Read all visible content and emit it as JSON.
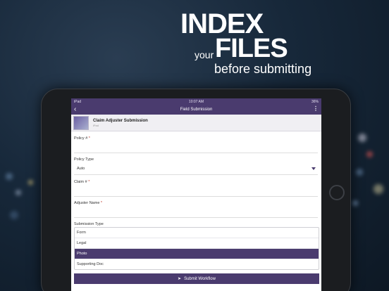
{
  "headline": {
    "line1": "INDEX",
    "your": "your",
    "line2": "FILES",
    "line3": "before submitting"
  },
  "status_bar": {
    "carrier": "iPad",
    "time": "10:07 AM",
    "battery": "36%"
  },
  "nav": {
    "title": "Field Submission"
  },
  "workflow": {
    "title": "Claim Adjuster Submission",
    "subtitle": "iPad"
  },
  "fields": {
    "policy_num_label": "Policy #",
    "policy_type_label": "Policy Type",
    "policy_type_value": "Auto",
    "claim_num_label": "Claim #",
    "adjuster_name_label": "Adjuster Name",
    "submission_type_label": "Submission Type",
    "required_mark": "*"
  },
  "submission_options": [
    "Form",
    "Legal",
    "Photo",
    "Supporting Doc"
  ],
  "selected_submission_option": "Photo",
  "submit": {
    "label": "Submit Workflow"
  },
  "colors": {
    "accent": "#4a3b6e"
  }
}
